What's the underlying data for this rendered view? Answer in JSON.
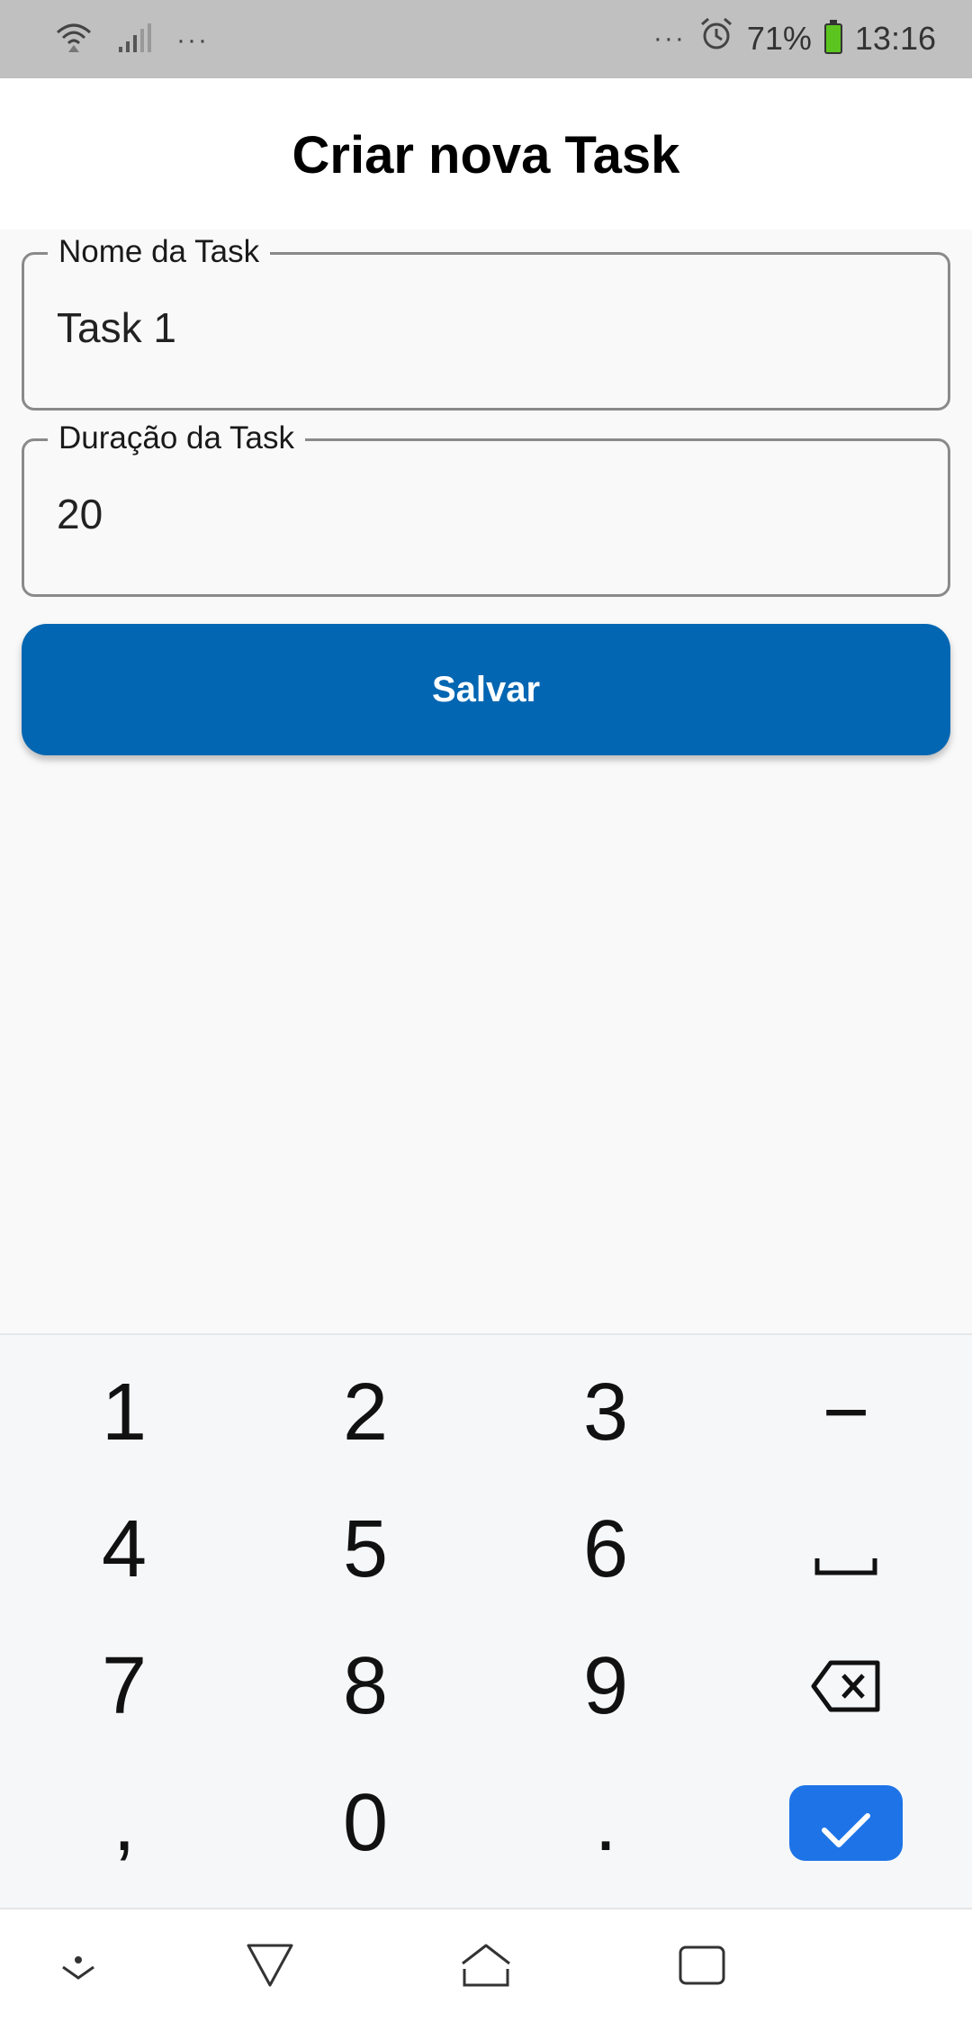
{
  "status_bar": {
    "left_icons": [
      "wifi-icon",
      "signal-icon"
    ],
    "left_more": "···",
    "right_more": "···",
    "alarm_icon": "alarm-icon",
    "battery_percent": "71%",
    "battery_icon": "battery-charging-icon",
    "time": "13:16"
  },
  "header": {
    "title": "Criar nova Task"
  },
  "form": {
    "name_field": {
      "label": "Nome da Task",
      "value": "Task 1"
    },
    "duration_field": {
      "label": "Duração da Task",
      "value": "20"
    },
    "save_label": "Salvar"
  },
  "keyboard": {
    "row1": [
      "1",
      "2",
      "3",
      "−"
    ],
    "row2": [
      "4",
      "5",
      "6"
    ],
    "row3": [
      "7",
      "8",
      "9"
    ],
    "row4": [
      ",",
      "0",
      "."
    ],
    "space_icon": "space-icon",
    "backspace_icon": "backspace-icon",
    "confirm_icon": "checkmark-icon"
  },
  "nav_bar": {
    "icons": [
      "hide-keyboard-icon",
      "back-icon",
      "home-icon",
      "recents-icon"
    ]
  },
  "colors": {
    "primary": "#0366b2",
    "confirm": "#1e74e7",
    "status_bar_bg": "#c0c0c0"
  }
}
